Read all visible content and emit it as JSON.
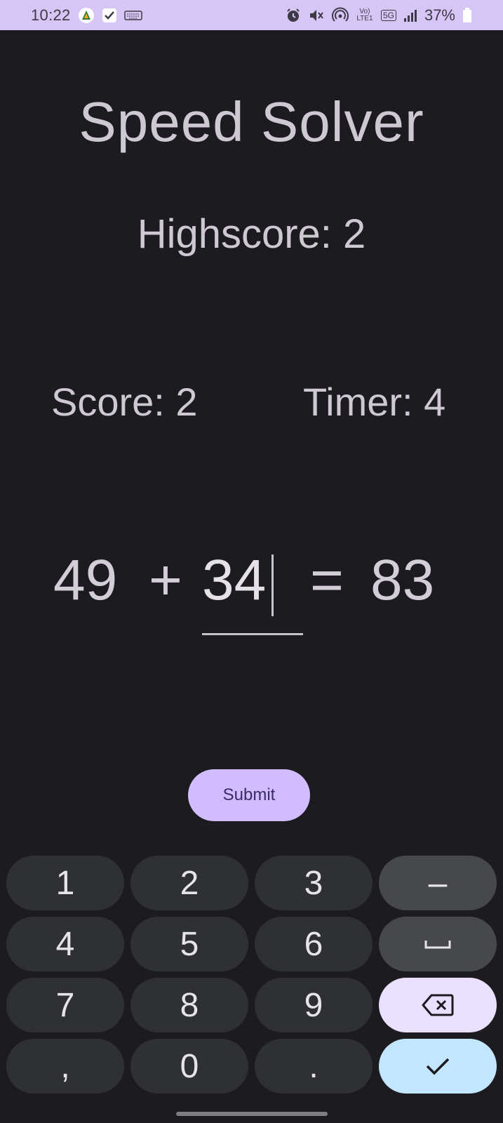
{
  "status_bar": {
    "time": "10:22",
    "battery": "37%",
    "network_volte": "Vo) LTE1",
    "network_5g": "5G"
  },
  "app": {
    "title": "Speed Solver",
    "highscore": "Highscore: 2",
    "score": "Score: 2",
    "timer": "Timer: 4",
    "equation": {
      "operand1": "49",
      "operator": "+",
      "input_value": "34",
      "equals": "=",
      "result": "83"
    },
    "submit_label": "Submit"
  },
  "keyboard": {
    "rows": [
      [
        "1",
        "2",
        "3",
        "–"
      ],
      [
        "4",
        "5",
        "6",
        "␣"
      ],
      [
        "7",
        "8",
        "9",
        "⌫"
      ],
      [
        ",",
        "0",
        ".",
        "✓"
      ]
    ]
  },
  "colors": {
    "background": "#1c1b20",
    "status_bar": "#d6c6f6",
    "accent": "#d0bcff",
    "key": "#2e3033",
    "key_function": "#47484b",
    "key_backspace": "#eae0ff",
    "key_enter": "#c2e6ff"
  }
}
